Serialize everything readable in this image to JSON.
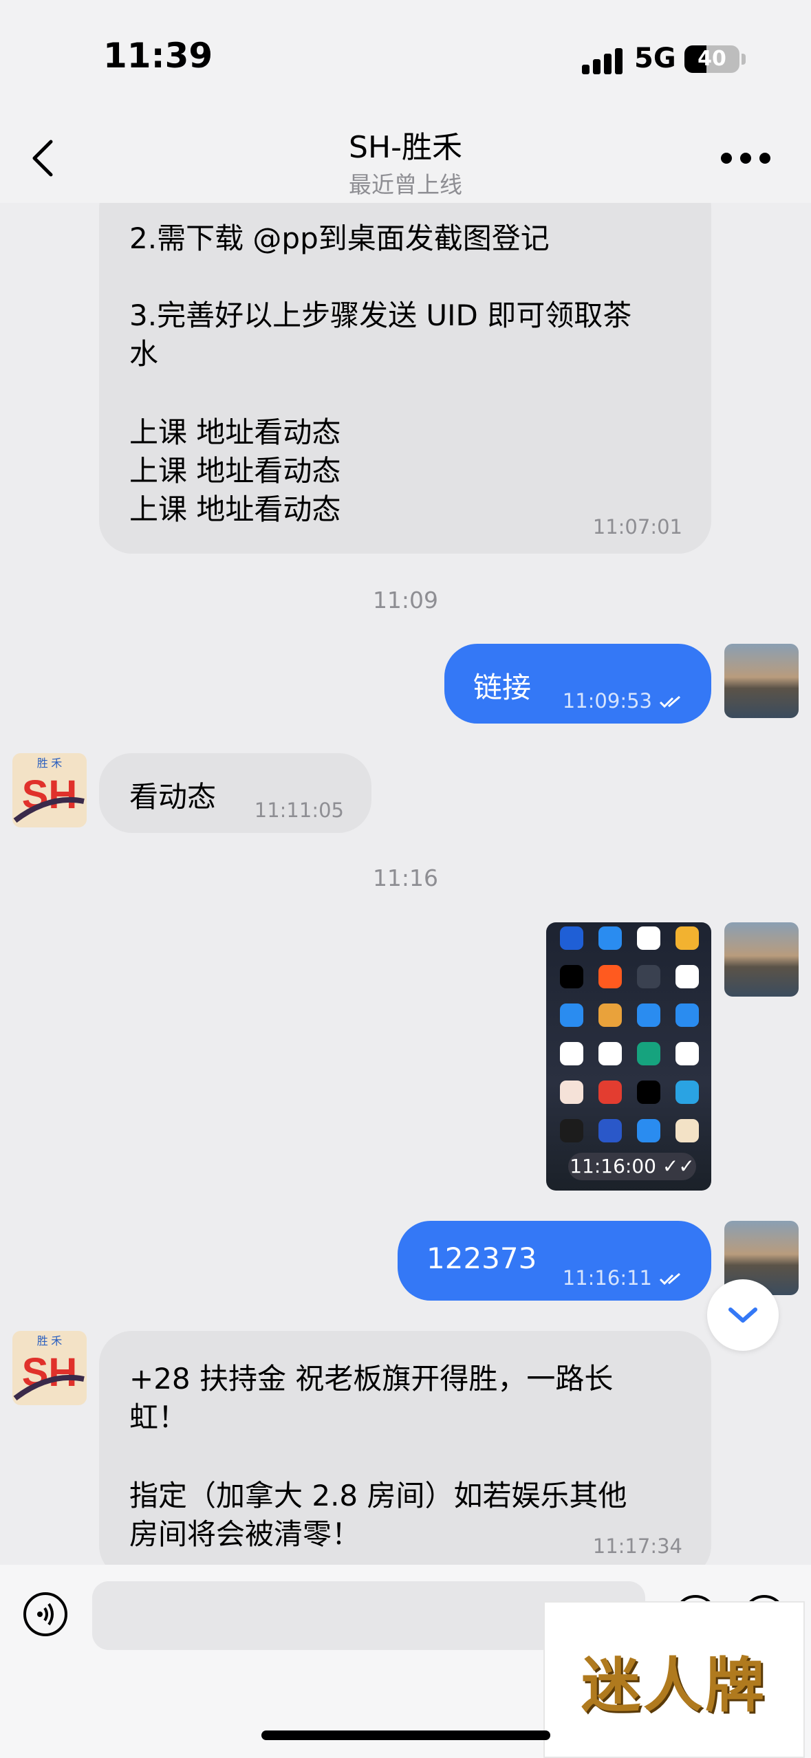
{
  "status_bar": {
    "time": "11:39",
    "network": "5G",
    "battery": "40",
    "battery_level": 0.4
  },
  "header": {
    "title": "SH-胜禾",
    "subtitle": "最近曾上线"
  },
  "messages": {
    "m1": {
      "lines": [
        "2.需下载 @pp到桌面发截图登记",
        "3.完善好以上步骤发送 UID 即可领取茶",
        "水",
        "上课 地址看动态",
        "上课 地址看动态",
        "上课 地址看动态"
      ],
      "time": "11:07:01"
    },
    "sep1": "11:09",
    "m2": {
      "text": "链接",
      "time": "11:09:53"
    },
    "m3": {
      "text": "看动态",
      "time": "11:11:05"
    },
    "sep2": "11:16",
    "m4": {
      "time": "11:16:00"
    },
    "m5": {
      "text": "122373",
      "time": "11:16:11"
    },
    "m6": {
      "lines": [
        "+28 扶持金   祝老板旗开得胜，一路长",
        "虹！",
        "指定（加拿大 2.8 房间）如若娱乐其他",
        "房间将会被清零！"
      ],
      "time": "11:17:34"
    }
  },
  "avatar_logo": {
    "top_text": "胜  禾",
    "logo_text": "SH"
  },
  "watermark": "迷人牌",
  "colors": {
    "outgoing_bubble": "#3478f6",
    "incoming_bubble": "#e2e2e4",
    "background": "#ededef"
  },
  "icons": [
    "back-chevron-icon",
    "more-dots-icon",
    "voice-icon",
    "read-check-icon",
    "scroll-down-icon"
  ]
}
